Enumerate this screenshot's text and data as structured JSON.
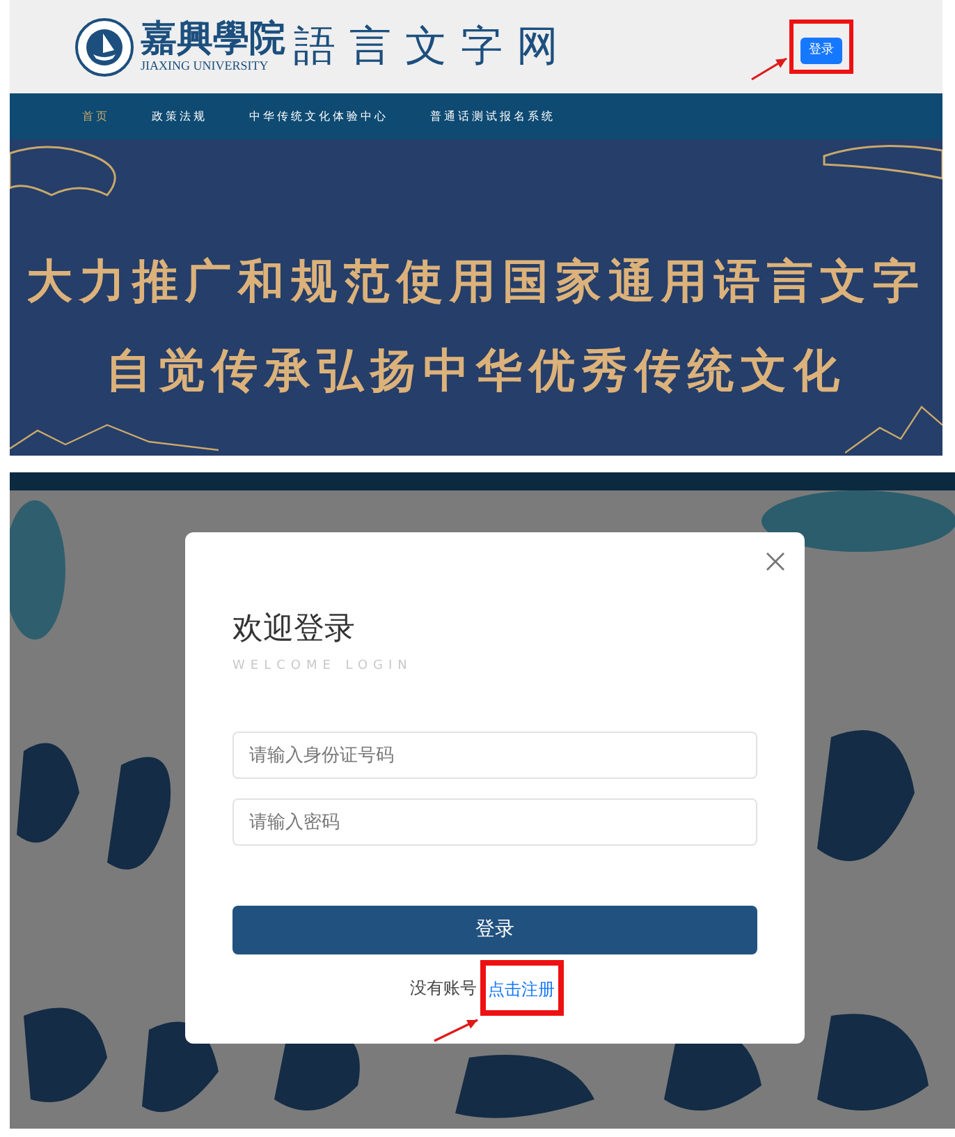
{
  "top_screen": {
    "header": {
      "school_name": "嘉興學院",
      "english_name": "JIAXING UNIVERSITY",
      "site_name": "語言文字网",
      "login_button": "登录"
    },
    "nav": [
      {
        "label": "首页",
        "selected": true
      },
      {
        "label": "政策法规",
        "selected": false
      },
      {
        "label": "中华传统文化体验中心",
        "selected": false
      },
      {
        "label": "普通话测试报名系统",
        "selected": false
      }
    ],
    "banner": {
      "slogans": [
        "大力推广和规范使用国家通用语言文字",
        "自觉传承弘扬中华优秀传统文化"
      ]
    }
  },
  "bottom_screen": {
    "modal": {
      "title": "欢迎登录",
      "subtitle": "WELCOME LOGIN",
      "fields": [
        {
          "placeholder": "请输入身份证号码"
        },
        {
          "placeholder": "请输入密码"
        }
      ],
      "submit_button": "登录",
      "prompt": "没有账号",
      "register_link": "点击注册"
    }
  }
}
